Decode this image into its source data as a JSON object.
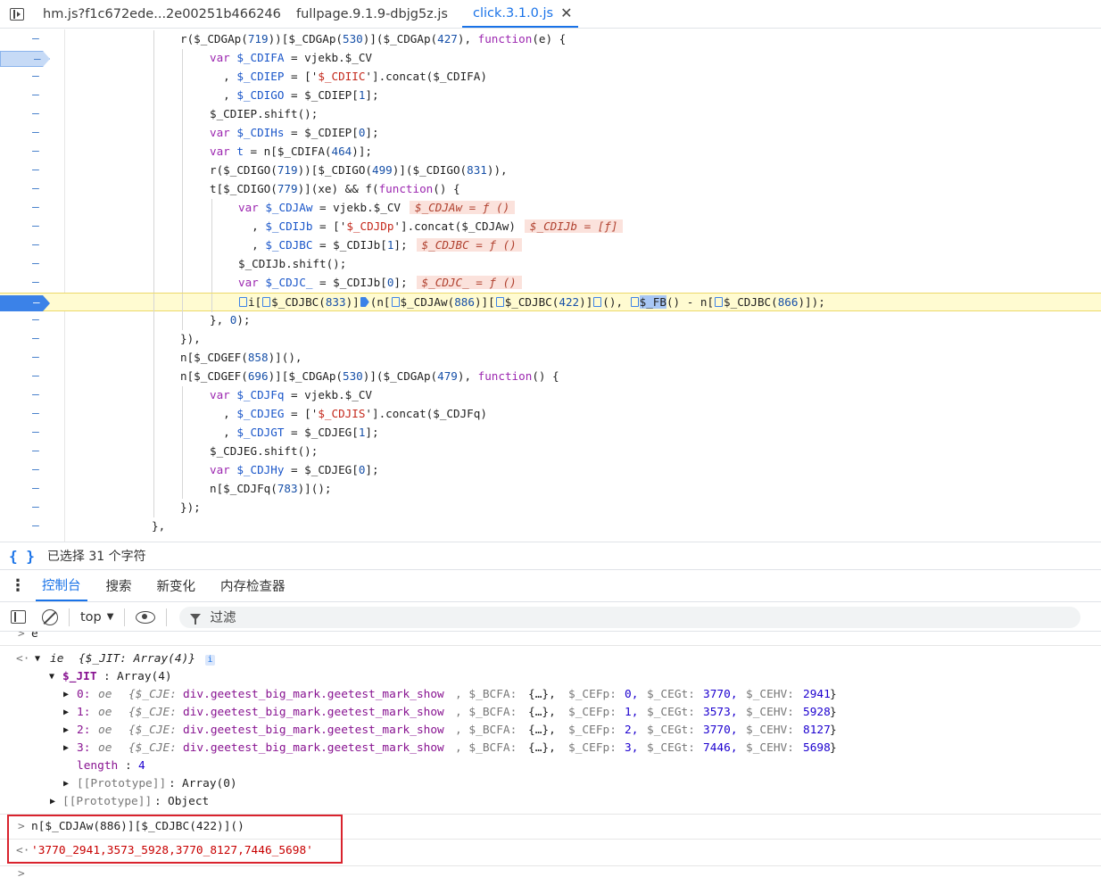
{
  "tabs": [
    {
      "label": "hm.js?f1c672ede...2e00251b466246",
      "active": false
    },
    {
      "label": "fullpage.9.1.9-dbjg5z.js",
      "active": false
    },
    {
      "label": "click.3.1.0.js",
      "active": true
    }
  ],
  "editor": {
    "gutter_marker": "–",
    "lines": [
      {
        "html": "r($_CDGAp(<n>719</n>))[$_CDGAp(<n>530</n>)]($_CDGAp(<n>427</n>), <k>function</k>(e) {",
        "indent": 202
      },
      {
        "html": "<k>var</k> <v>$_CDIFA</v> = vjekb.$_CV",
        "indent": 235,
        "bp": "pale"
      },
      {
        "html": "  , <v>$_CDIEP</v> = ['<s>$_CDIIC</s>'].concat($_CDIFA)",
        "indent": 235
      },
      {
        "html": "  , <v>$_CDIGO</v> = $_CDIEP[<n>1</n>];",
        "indent": 235
      },
      {
        "html": "$_CDIEP.shift();",
        "indent": 235
      },
      {
        "html": "<k>var</k> <v>$_CDIHs</v> = $_CDIEP[<n>0</n>];",
        "indent": 235
      },
      {
        "html": "<k>var</k> <v>t</v> = n[$_CDIFA(<n>464</n>)];",
        "indent": 235
      },
      {
        "html": "r($_CDIGO(<n>719</n>))[$_CDIGO(<n>499</n>)]($_CDIGO(<n>831</n>)),",
        "indent": 235
      },
      {
        "html": "t[$_CDIGO(<n>779</n>)](xe) && f(<k>function</k>() {",
        "indent": 235
      },
      {
        "html": "<k>var</k> <v>$_CDJAw</v> = vjekb.$_CV<i>$_CDJAw = ƒ ()</i>",
        "indent": 267
      },
      {
        "html": "  , <v>$_CDIJb</v> = ['<s>$_CDJDp</s>'].concat($_CDJAw)<i>$_CDIJb = [ƒ]</i>",
        "indent": 267
      },
      {
        "html": "  , <v>$_CDJBC</v> = $_CDIJb[<n>1</n>];<i>$_CDJBC = ƒ ()</i>",
        "indent": 267
      },
      {
        "html": "$_CDIJb.shift();",
        "indent": 267
      },
      {
        "html": "<k>var</k> <v>$_CDJC_</v> = $_CDIJb[<n>0</n>];<i>$_CDJC_ = ƒ ()</i>",
        "indent": 267
      },
      {
        "html": "<m></m>i[<m></m>$_CDJBC(<n>833</n>)]<f></f>(n[<m></m>$_CDJAw(<n>886</n>)][<m></m>$_CDJBC(<n>422</n>)]<m></m>(), <m></m><sel>$_FB</sel>() - n[<m></m>$_CDJBC(<n>866</n>)]);",
        "indent": 267,
        "bp": "solid",
        "current": true
      },
      {
        "html": "}, <n>0</n>);",
        "indent": 235
      },
      {
        "html": "}),",
        "indent": 202
      },
      {
        "html": "n[$_CDGEF(<n>858</n>)](),",
        "indent": 202
      },
      {
        "html": "n[$_CDGEF(<n>696</n>)][$_CDGAp(<n>530</n>)]($_CDGAp(<n>479</n>), <k>function</k>() {",
        "indent": 202
      },
      {
        "html": "<k>var</k> <v>$_CDJFq</v> = vjekb.$_CV",
        "indent": 235
      },
      {
        "html": "  , <v>$_CDJEG</v> = ['<s>$_CDJIS</s>'].concat($_CDJFq)",
        "indent": 235
      },
      {
        "html": "  , <v>$_CDJGT</v> = $_CDJEG[<n>1</n>];",
        "indent": 235
      },
      {
        "html": "$_CDJEG.shift();",
        "indent": 235
      },
      {
        "html": "<k>var</k> <v>$_CDJHy</v> = $_CDJEG[<n>0</n>];",
        "indent": 235
      },
      {
        "html": "n[$_CDJFq(<n>783</n>)]();",
        "indent": 235
      },
      {
        "html": "});",
        "indent": 202
      },
      {
        "html": "},",
        "indent": 170
      }
    ]
  },
  "status": {
    "braces": "{ }",
    "selection_text": "已选择 31 个字符"
  },
  "drawer_tabs": [
    {
      "label": "控制台",
      "active": true
    },
    {
      "label": "搜索",
      "active": false
    },
    {
      "label": "新变化",
      "active": false
    },
    {
      "label": "内存检查器",
      "active": false
    }
  ],
  "toolbar": {
    "context": "top",
    "filter_placeholder": "过滤"
  },
  "console": {
    "line_e": "e",
    "obj_name": "ie",
    "obj_preview": "{$_JIT: Array(4)}",
    "jit_key": "$_JIT",
    "jit_type": "Array(4)",
    "items": [
      {
        "idx": "0",
        "cefp": "0",
        "cegt": "3770",
        "cehv": "2941"
      },
      {
        "idx": "1",
        "cefp": "1",
        "cegt": "3573",
        "cehv": "5928"
      },
      {
        "idx": "2",
        "cefp": "2",
        "cegt": "3770",
        "cehv": "8127"
      },
      {
        "idx": "3",
        "cefp": "3",
        "cegt": "7446",
        "cehv": "5698"
      }
    ],
    "item_class": "oe",
    "cje_key": "$_CJE",
    "cje_val": "div.geetest_big_mark.geetest_mark_show",
    "bcfa_key": "$_BCFA",
    "bcfa_val": "{…}",
    "cefp_key": "$_CEFp",
    "cegt_key": "$_CEGt",
    "cehv_key": "$_CEHV",
    "length_key": "length",
    "length_val": "4",
    "proto_key": "[[Prototype]]",
    "proto_array": "Array(0)",
    "proto_obj": "Object",
    "input_cmd": "n[$_CDJAw(886)][$_CDJBC(422)]()",
    "result": "'3770_2941,3573_5928,3770_8127,7446_5698'",
    "prompt": ">",
    "return_arrow": "<·",
    "expand_arrow": "▶",
    "collapse_arrow": "▼"
  },
  "colors": {
    "accent": "#1a73e8",
    "breakpoint": "#3b82e8",
    "current_line": "#fffbd1",
    "highlight_box": "#d9232d"
  }
}
